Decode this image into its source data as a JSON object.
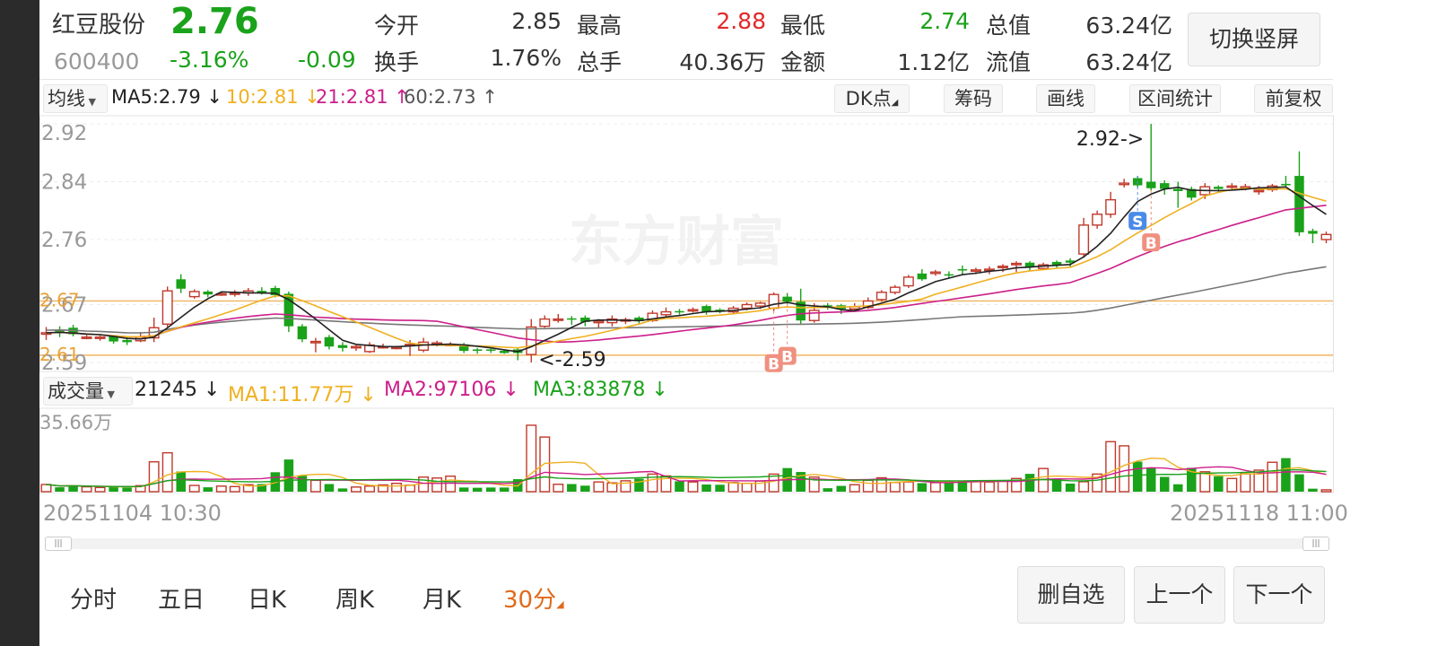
{
  "header": {
    "stock_name": "红豆股份",
    "stock_code": "600400",
    "price": "2.76",
    "change_pct": "-3.16%",
    "change": "-0.09",
    "open_label": "今开",
    "open_value": "2.85",
    "high_label": "最高",
    "high_value": "2.88",
    "low_label": "最低",
    "low_value": "2.74",
    "total_value_label": "总值",
    "total_value": "63.24亿",
    "turnover_label": "换手",
    "turnover_value": "1.76%",
    "total_volume_label": "总手",
    "total_volume_value": "40.36万",
    "amount_label": "金额",
    "amount_value": "1.12亿",
    "float_value_label": "流值",
    "float_value": "63.24亿",
    "switch_button": "切换竖屏"
  },
  "toolbar": {
    "ma_select": "均线",
    "ma5": "MA5:2.79 ↓",
    "ma10": "10:2.81 ↓",
    "ma21": "21:2.81 ↑",
    "ma60": "60:2.73 ↑",
    "dk_button": "DK点",
    "chip_button": "筹码",
    "draw_button": "画线",
    "range_button": "区间统计",
    "adjust_button": "前复权"
  },
  "volume_bar": {
    "select": "成交量",
    "current": "21245 ↓",
    "ma1": "MA1:11.77万 ↓",
    "ma2": "MA2:97106 ↓",
    "ma3": "MA3:83878 ↓"
  },
  "watermark": "东方财富",
  "tabs": [
    "分时",
    "五日",
    "日K",
    "周K",
    "月K",
    "30分"
  ],
  "active_tab": "30分",
  "bottom_buttons": {
    "remove_watch": "删自选",
    "prev": "上一个",
    "next": "下一个"
  },
  "colors": {
    "up": "#c0392b",
    "down": "#1aa21a",
    "ma5": "#222222",
    "ma10": "#f0b020",
    "ma21": "#cc1f8a",
    "ma60": "#777777",
    "accent": "#e06a1a"
  },
  "chart_data": {
    "type": "candlestick",
    "interval": "30min",
    "y_ticks": [
      "2.92",
      "2.84",
      "2.76",
      "2.67",
      "2.59"
    ],
    "ylim": [
      2.58,
      2.93
    ],
    "high_marker": "2.92->",
    "low_marker": "<-2.59",
    "reference_lines": [
      {
        "label": "2.67",
        "value": 2.675
      },
      {
        "label": "2.61",
        "value": 2.6
      }
    ],
    "x_start_label": "20251104 10:30",
    "x_end_label": "20251118 11:00",
    "volume_axis_label": "35.66万",
    "volume_max": 356600,
    "signals": [
      {
        "label": "B",
        "index": 54
      },
      {
        "label": "B",
        "index": 55
      },
      {
        "label": "S",
        "index": 81
      },
      {
        "label": "B",
        "index": 82
      }
    ],
    "candles": [
      [
        2.629,
        2.631,
        2.639,
        2.621
      ],
      [
        2.635,
        2.632,
        2.64,
        2.625
      ],
      [
        2.638,
        2.629,
        2.642,
        2.626
      ],
      [
        2.625,
        2.625,
        2.628,
        2.622
      ],
      [
        2.624,
        2.625,
        2.627,
        2.62
      ],
      [
        2.626,
        2.619,
        2.628,
        2.616
      ],
      [
        2.621,
        2.618,
        2.625,
        2.614
      ],
      [
        2.62,
        2.625,
        2.632,
        2.618
      ],
      [
        2.624,
        2.638,
        2.652,
        2.618
      ],
      [
        2.643,
        2.689,
        2.695,
        2.639
      ],
      [
        2.705,
        2.692,
        2.712,
        2.686
      ],
      [
        2.681,
        2.688,
        2.691,
        2.678
      ],
      [
        2.688,
        2.684,
        2.69,
        2.68
      ],
      [
        2.685,
        2.685,
        2.688,
        2.682
      ],
      [
        2.685,
        2.686,
        2.69,
        2.681
      ],
      [
        2.686,
        2.689,
        2.693,
        2.682
      ],
      [
        2.689,
        2.686,
        2.694,
        2.684
      ],
      [
        2.693,
        2.683,
        2.696,
        2.68
      ],
      [
        2.685,
        2.64,
        2.688,
        2.632
      ],
      [
        2.64,
        2.622,
        2.643,
        2.618
      ],
      [
        2.619,
        2.619,
        2.624,
        2.604
      ],
      [
        2.625,
        2.612,
        2.628,
        2.608
      ],
      [
        2.614,
        2.61,
        2.618,
        2.605
      ],
      [
        2.611,
        2.612,
        2.614,
        2.606
      ],
      [
        2.605,
        2.614,
        2.618,
        2.603
      ],
      [
        2.612,
        2.612,
        2.616,
        2.609
      ],
      [
        2.611,
        2.611,
        2.613,
        2.608
      ],
      [
        2.615,
        2.615,
        2.621,
        2.599
      ],
      [
        2.607,
        2.618,
        2.624,
        2.604
      ],
      [
        2.616,
        2.617,
        2.62,
        2.612
      ],
      [
        2.615,
        2.615,
        2.618,
        2.612
      ],
      [
        2.615,
        2.606,
        2.617,
        2.603
      ],
      [
        2.608,
        2.606,
        2.61,
        2.602
      ],
      [
        2.608,
        2.607,
        2.609,
        2.603
      ],
      [
        2.606,
        2.603,
        2.607,
        2.602
      ],
      [
        2.608,
        2.603,
        2.611,
        2.593
      ],
      [
        2.601,
        2.639,
        2.65,
        2.59
      ],
      [
        2.64,
        2.65,
        2.655,
        2.638
      ],
      [
        2.65,
        2.65,
        2.657,
        2.645
      ],
      [
        2.651,
        2.65,
        2.654,
        2.642
      ],
      [
        2.652,
        2.646,
        2.655,
        2.64
      ],
      [
        2.645,
        2.647,
        2.65,
        2.638
      ],
      [
        2.645,
        2.65,
        2.655,
        2.64
      ],
      [
        2.649,
        2.649,
        2.652,
        2.643
      ],
      [
        2.652,
        2.647,
        2.654,
        2.644
      ],
      [
        2.648,
        2.658,
        2.662,
        2.646
      ],
      [
        2.656,
        2.66,
        2.666,
        2.652
      ],
      [
        2.661,
        2.66,
        2.664,
        2.656
      ],
      [
        2.662,
        2.663,
        2.666,
        2.659
      ],
      [
        2.668,
        2.66,
        2.67,
        2.656
      ],
      [
        2.663,
        2.661,
        2.665,
        2.658
      ],
      [
        2.66,
        2.665,
        2.668,
        2.657
      ],
      [
        2.665,
        2.67,
        2.673,
        2.662
      ],
      [
        2.668,
        2.672,
        2.674,
        2.664
      ],
      [
        2.665,
        2.684,
        2.687,
        2.661
      ],
      [
        2.681,
        2.674,
        2.686,
        2.671
      ],
      [
        2.674,
        2.648,
        2.692,
        2.642
      ],
      [
        2.648,
        2.662,
        2.672,
        2.645
      ],
      [
        2.669,
        2.667,
        2.672,
        2.663
      ],
      [
        2.669,
        2.664,
        2.671,
        2.657
      ],
      [
        2.664,
        2.667,
        2.672,
        2.662
      ],
      [
        2.666,
        2.675,
        2.68,
        2.664
      ],
      [
        2.677,
        2.687,
        2.69,
        2.674
      ],
      [
        2.687,
        2.694,
        2.697,
        2.684
      ],
      [
        2.696,
        2.708,
        2.711,
        2.693
      ],
      [
        2.713,
        2.705,
        2.719,
        2.703
      ],
      [
        2.713,
        2.715,
        2.718,
        2.71
      ],
      [
        2.712,
        2.711,
        2.716,
        2.707
      ],
      [
        2.719,
        2.718,
        2.724,
        2.711
      ],
      [
        2.717,
        2.718,
        2.721,
        2.712
      ],
      [
        2.719,
        2.719,
        2.723,
        2.712
      ],
      [
        2.723,
        2.723,
        2.726,
        2.715
      ],
      [
        2.727,
        2.727,
        2.73,
        2.715
      ],
      [
        2.728,
        2.722,
        2.73,
        2.716
      ],
      [
        2.72,
        2.725,
        2.728,
        2.718
      ],
      [
        2.729,
        2.725,
        2.731,
        2.72
      ],
      [
        2.731,
        2.728,
        2.734,
        2.722
      ],
      [
        2.74,
        2.78,
        2.79,
        2.735
      ],
      [
        2.78,
        2.795,
        2.8,
        2.775
      ],
      [
        2.795,
        2.815,
        2.826,
        2.79
      ],
      [
        2.836,
        2.838,
        2.844,
        2.832
      ],
      [
        2.845,
        2.835,
        2.848,
        2.832
      ],
      [
        2.84,
        2.831,
        2.92,
        2.828
      ],
      [
        2.838,
        2.83,
        2.842,
        2.822
      ],
      [
        2.83,
        2.827,
        2.84,
        2.804
      ],
      [
        2.83,
        2.818,
        2.833,
        2.814
      ],
      [
        2.822,
        2.833,
        2.838,
        2.816
      ],
      [
        2.833,
        2.83,
        2.835,
        2.826
      ],
      [
        2.834,
        2.834,
        2.838,
        2.83
      ],
      [
        2.833,
        2.833,
        2.837,
        2.828
      ],
      [
        2.828,
        2.828,
        2.834,
        2.822
      ],
      [
        2.829,
        2.834,
        2.837,
        2.826
      ],
      [
        2.837,
        2.835,
        2.848,
        2.832
      ],
      [
        2.848,
        2.77,
        2.882,
        2.765
      ],
      [
        2.772,
        2.768,
        2.775,
        2.755
      ],
      [
        2.76,
        2.767,
        2.771,
        2.755
      ]
    ],
    "volumes": [
      31000,
      19000,
      26000,
      21000,
      18000,
      21000,
      18000,
      26000,
      129000,
      168000,
      87000,
      27000,
      19000,
      24000,
      22000,
      30000,
      33000,
      84000,
      139000,
      69000,
      49000,
      33000,
      14000,
      20000,
      24000,
      29000,
      36000,
      28000,
      63000,
      59000,
      67000,
      18000,
      17000,
      18000,
      18000,
      54000,
      287000,
      236000,
      32000,
      33000,
      26000,
      42000,
      38000,
      47000,
      56000,
      76000,
      68000,
      45000,
      42000,
      31000,
      30000,
      39000,
      36000,
      46000,
      76000,
      102000,
      85000,
      63000,
      15000,
      25000,
      30000,
      49000,
      60000,
      40000,
      42000,
      37000,
      39000,
      48000,
      43000,
      45000,
      41000,
      47000,
      57000,
      77000,
      100000,
      56000,
      35000,
      43000,
      76000,
      216000,
      198000,
      130000,
      103000,
      64000,
      32000,
      103000,
      86000,
      67000,
      57000,
      77000,
      93000,
      127000,
      145000,
      75000,
      13000,
      8000
    ]
  }
}
